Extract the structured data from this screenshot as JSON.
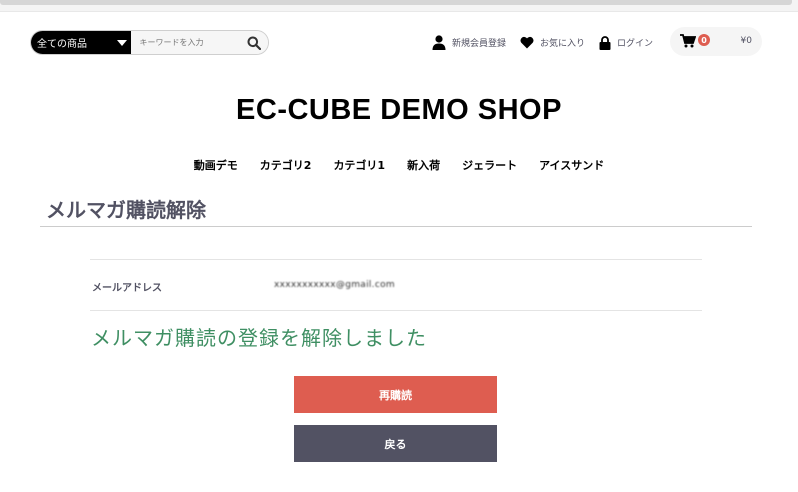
{
  "search": {
    "category_selected": "全ての商品",
    "keyword_placeholder": "キーワードを入力"
  },
  "header": {
    "links": {
      "signup": "新規会員登録",
      "favorites": "お気に入り",
      "login": "ログイン"
    },
    "cart": {
      "count": "0",
      "total": "¥0"
    }
  },
  "shop": {
    "title": "EC-CUBE DEMO SHOP"
  },
  "category_nav": [
    "動画デモ",
    "カテゴリ2",
    "カテゴリ1",
    "新入荷",
    "ジェラート",
    "アイスサンド"
  ],
  "page": {
    "title": "メルマガ購読解除",
    "email_label": "メールアドレス",
    "email_value": "xxxxxxxxxxx@gmail.com",
    "message": "メルマガ購読の登録を解除しました",
    "resubscribe_button": "再購読",
    "back_button": "戻る"
  },
  "colors": {
    "accent": "#de5d50",
    "dark": "#525263",
    "success": "#3f8f63"
  },
  "icons": [
    "caret-down-icon",
    "search-icon",
    "user-icon",
    "heart-icon",
    "lock-icon",
    "cart-icon"
  ]
}
